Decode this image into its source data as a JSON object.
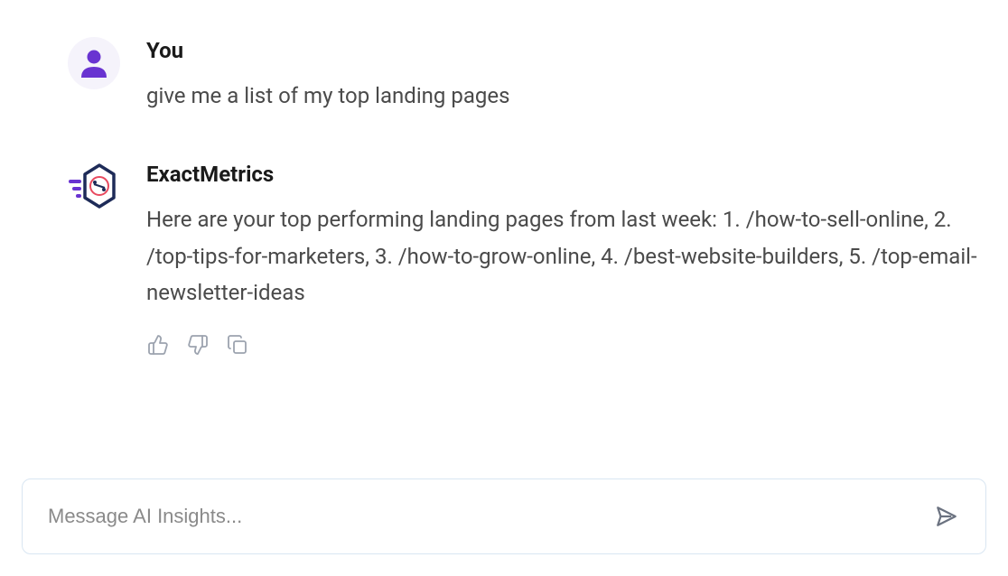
{
  "messages": {
    "user": {
      "author": "You",
      "text": "give me a list of my top landing pages"
    },
    "assistant": {
      "author": "ExactMetrics",
      "text": "Here are your top performing landing pages from last week: 1. /how-to-sell-online, 2. /top-tips-for-marketers, 3. /how-to-grow-online, 4. /best-website-builders, 5. /top-email-newsletter-ideas"
    }
  },
  "input": {
    "placeholder": "Message AI Insights..."
  }
}
